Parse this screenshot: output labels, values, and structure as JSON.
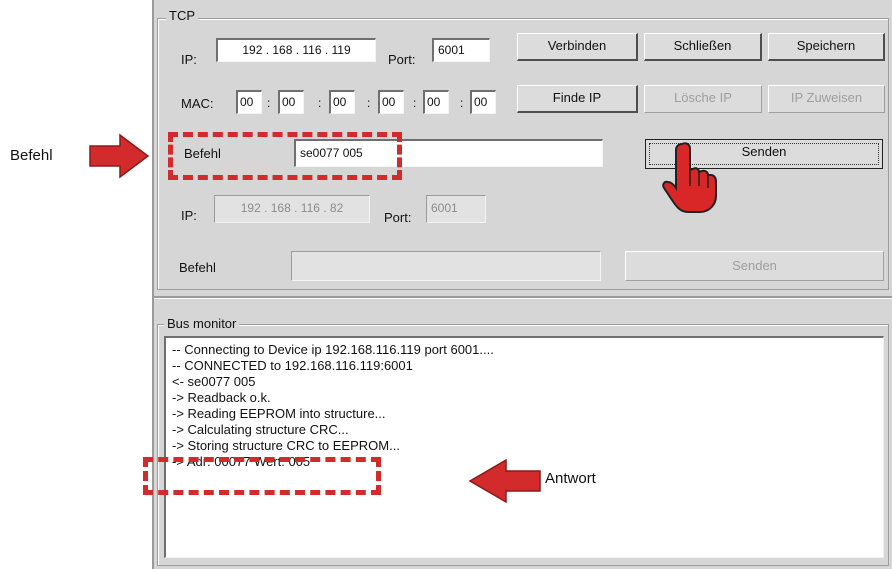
{
  "callouts": {
    "befehl": "Befehl",
    "antwort": "Antwort"
  },
  "tcp": {
    "group_label": "TCP",
    "ip_label": "IP:",
    "ip_value": "192 . 168 . 116 . 119",
    "port_label": "Port:",
    "port_value": "6001",
    "mac_label": "MAC:",
    "mac": [
      "00",
      "00",
      "00",
      "00",
      "00",
      "00"
    ],
    "mac_sep": ":",
    "buttons": {
      "connect": "Verbinden",
      "close": "Schließen",
      "save": "Speichern",
      "find_ip": "Finde IP",
      "delete_ip": "Lösche IP",
      "assign_ip": "IP Zuweisen",
      "send": "Senden"
    },
    "befehl_label": "Befehl",
    "befehl_value": "se0077 005",
    "ip2_label": "IP:",
    "ip2_value": "192 . 168 . 116 . 82",
    "port2_label": "Port:",
    "port2_value": "6001",
    "befehl2_label": "Befehl",
    "befehl2_value": "",
    "send2": "Senden"
  },
  "monitor": {
    "label": "Bus monitor",
    "lines": [
      "-- Connecting to Device ip 192.168.116.119 port 6001....",
      "-- CONNECTED to 192.168.116.119:6001",
      "<- se0077 005",
      "-> Readback o.k.",
      "-> Reading EEPROM into structure...",
      "-> Calculating structure CRC...",
      "-> Storing structure CRC to EEPROM...",
      "-> Adr: 00077 Wert: 005"
    ]
  },
  "colors": {
    "accent": "#d32b2b",
    "window_bg": "#d6d6d6"
  },
  "icons": {
    "pointer": "hand-pointer-icon",
    "arrow": "red-arrow-icon"
  }
}
